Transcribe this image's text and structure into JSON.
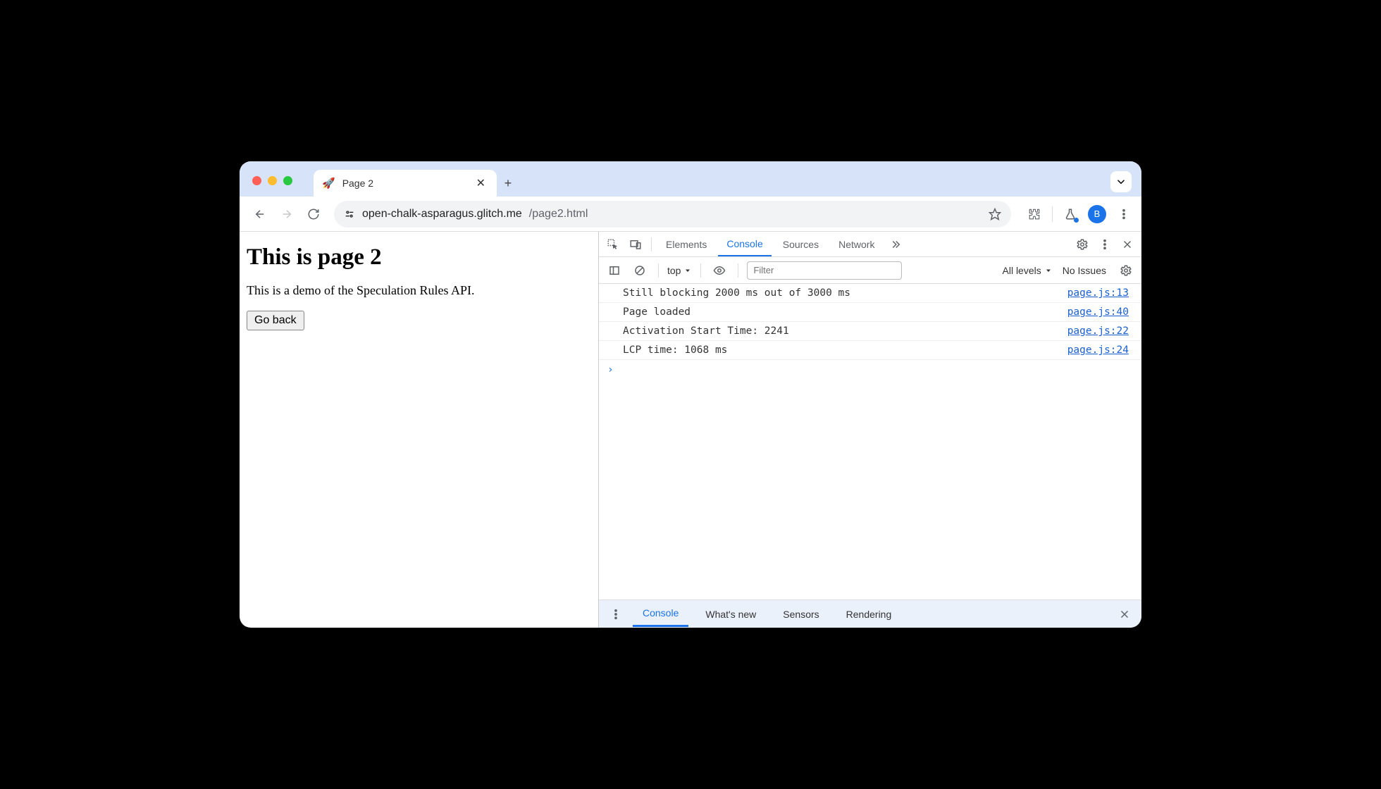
{
  "tab": {
    "favicon": "🚀",
    "title": "Page 2"
  },
  "omnibox": {
    "url_host": "open-chalk-asparagus.glitch.me",
    "url_path": "/page2.html"
  },
  "avatar_letter": "B",
  "page": {
    "heading": "This is page 2",
    "paragraph": "This is a demo of the Speculation Rules API.",
    "button": "Go back"
  },
  "devtools": {
    "tabs": [
      "Elements",
      "Console",
      "Sources",
      "Network"
    ],
    "active_tab": "Console",
    "context_selector": "top",
    "filter_placeholder": "Filter",
    "levels_label": "All levels",
    "issues_label": "No Issues",
    "logs": [
      {
        "msg": "Still blocking 2000 ms out of 3000 ms",
        "src": "page.js:13"
      },
      {
        "msg": "Page loaded",
        "src": "page.js:40"
      },
      {
        "msg": "Activation Start Time: 2241",
        "src": "page.js:22"
      },
      {
        "msg": "LCP time: 1068 ms",
        "src": "page.js:24"
      }
    ],
    "prompt": "›",
    "drawer_tabs": [
      "Console",
      "What's new",
      "Sensors",
      "Rendering"
    ],
    "drawer_active": "Console"
  }
}
